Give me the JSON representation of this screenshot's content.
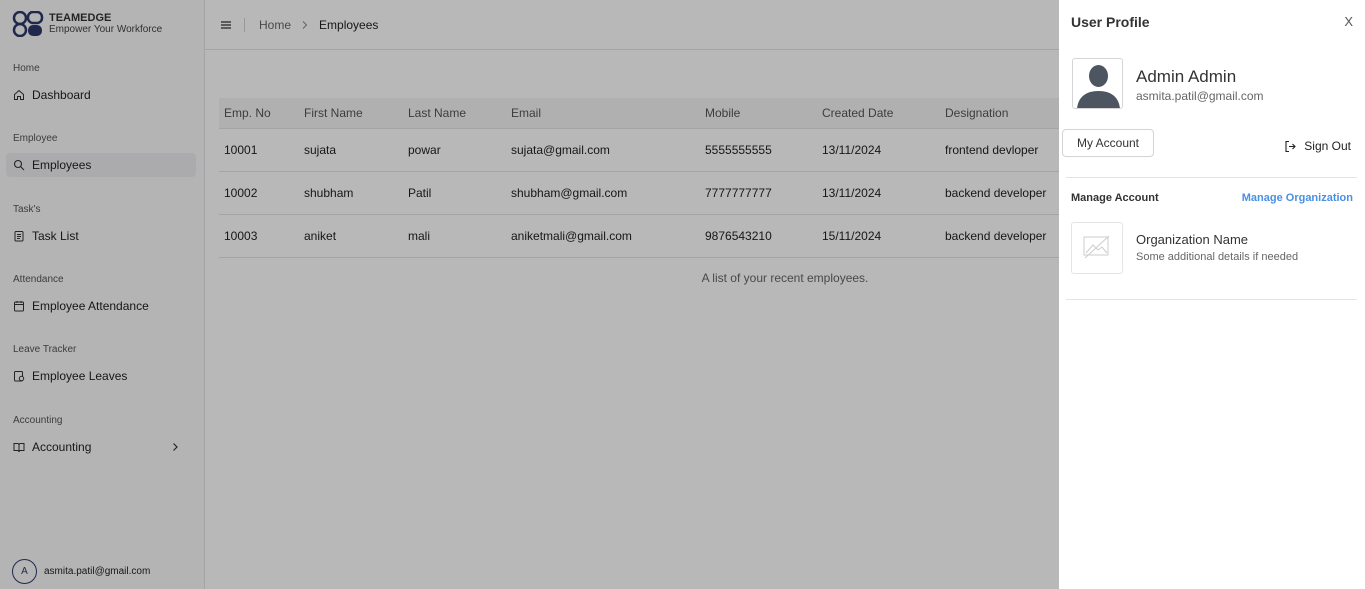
{
  "brand": {
    "name": "TEAMEDGE",
    "tagline": "Empower Your Workforce"
  },
  "sidebar": {
    "groups": [
      {
        "label": "Home",
        "item": "Dashboard"
      },
      {
        "label": "Employee",
        "item": "Employees"
      },
      {
        "label": "Task's",
        "item": "Task List"
      },
      {
        "label": "Attendance",
        "item": "Employee Attendance"
      },
      {
        "label": "Leave Tracker",
        "item": "Employee Leaves"
      },
      {
        "label": "Accounting",
        "item": "Accounting"
      }
    ],
    "user": {
      "initial": "A",
      "email": "asmita.patil@gmail.com"
    }
  },
  "breadcrumb": {
    "home": "Home",
    "current": "Employees"
  },
  "table": {
    "headers": [
      "Emp. No",
      "First Name",
      "Last Name",
      "Email",
      "Mobile",
      "Created Date",
      "Designation"
    ],
    "rows": [
      [
        "10001",
        "sujata",
        "powar",
        "sujata@gmail.com",
        "5555555555",
        "13/11/2024",
        "frontend devloper"
      ],
      [
        "10002",
        "shubham",
        "Patil",
        "shubham@gmail.com",
        "7777777777",
        "13/11/2024",
        "backend developer"
      ],
      [
        "10003",
        "aniket",
        "mali",
        "aniketmali@gmail.com",
        "9876543210",
        "15/11/2024",
        "backend developer"
      ]
    ],
    "caption": "A list of your recent employees."
  },
  "profile_panel": {
    "title": "User Profile",
    "close": "X",
    "name": "Admin Admin",
    "email": "asmita.patil@gmail.com",
    "my_account": "My Account",
    "sign_out": "Sign Out",
    "manage_account": "Manage Account",
    "manage_organization": "Manage Organization",
    "org_name": "Organization Name",
    "org_details": "Some additional details if needed"
  },
  "colors": {
    "link": "#4a90e2",
    "overlay": "rgba(0,0,0,0.28)"
  }
}
